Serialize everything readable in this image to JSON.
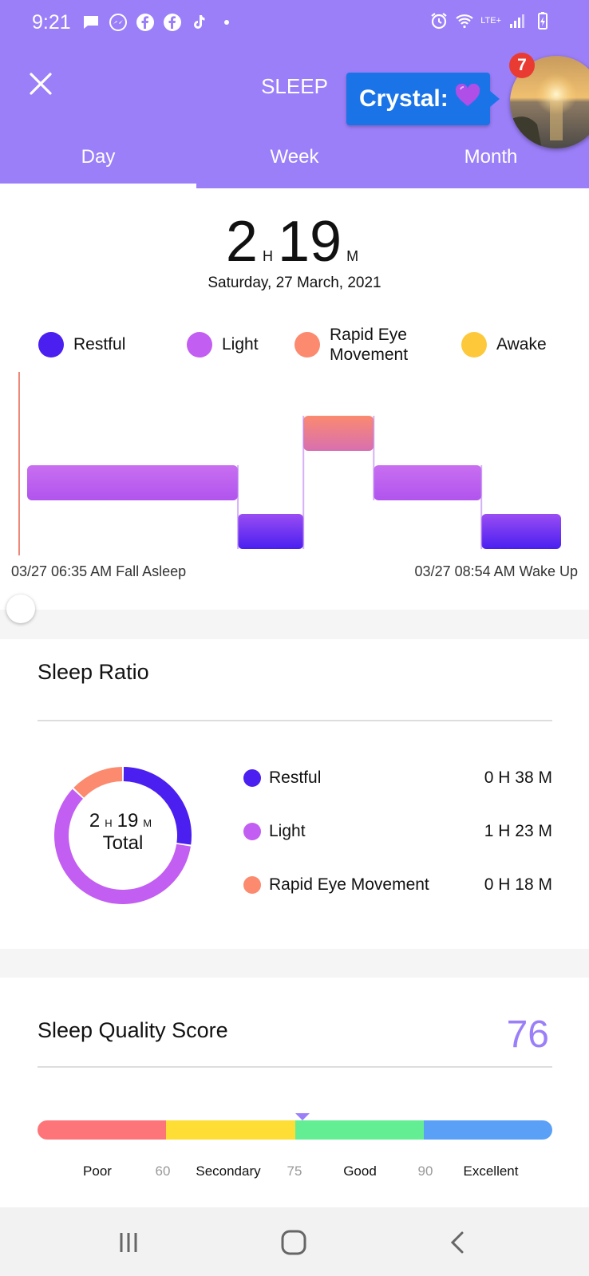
{
  "status_bar": {
    "time": "9:21",
    "lte_label": "LTE+"
  },
  "header": {
    "title": "SLEEP",
    "chat_head": {
      "label": "Crystal:",
      "badge_count": "7"
    },
    "tabs": [
      {
        "label": "Day",
        "active": true
      },
      {
        "label": "Week",
        "active": false
      },
      {
        "label": "Month",
        "active": false
      }
    ]
  },
  "summary": {
    "hours": "2",
    "hours_unit": "H",
    "minutes": "19",
    "minutes_unit": "M",
    "date": "Saturday, 27 March, 2021"
  },
  "legend": [
    {
      "label": "Restful",
      "color": "#4a1ff0"
    },
    {
      "label": "Light",
      "color": "#c25ef2"
    },
    {
      "label": "Rapid Eye\nMovement",
      "color": "#fb8a6f"
    },
    {
      "label": "Awake",
      "color": "#fdc93a"
    }
  ],
  "sleep_chart": {
    "start_label": "03/27 06:35 AM Fall Asleep",
    "end_label": "03/27 08:54 AM Wake Up",
    "stages": [
      {
        "stage": "Light",
        "minutes": 45
      },
      {
        "stage": "Restful",
        "minutes": 14
      },
      {
        "stage": "Rapid Eye Movement",
        "minutes": 15
      },
      {
        "stage": "Light",
        "minutes": 23
      },
      {
        "stage": "Restful",
        "minutes": 17
      }
    ]
  },
  "sleep_ratio": {
    "title": "Sleep Ratio",
    "total_hours": "2",
    "total_hours_unit": "H",
    "total_minutes": "19",
    "total_minutes_unit": "M",
    "total_label": "Total",
    "items": [
      {
        "label": "Restful",
        "value": "0 H 38 M",
        "minutes": 38,
        "color": "#4a1ff0"
      },
      {
        "label": "Light",
        "value": "1 H 23 M",
        "minutes": 83,
        "color": "#c25ef2"
      },
      {
        "label": "Rapid Eye Movement",
        "value": "0 H 18 M",
        "minutes": 18,
        "color": "#fb8a6f"
      }
    ]
  },
  "sleep_quality": {
    "title": "Sleep Quality Score",
    "score": "76",
    "segments": [
      {
        "label": "Poor",
        "color": "#fd7579"
      },
      {
        "label": "Secondary",
        "color": "#fedd35"
      },
      {
        "label": "Good",
        "color": "#64ee94"
      },
      {
        "label": "Excellent",
        "color": "#5aa0f7"
      }
    ],
    "thresholds": [
      "60",
      "75",
      "90"
    ]
  }
}
